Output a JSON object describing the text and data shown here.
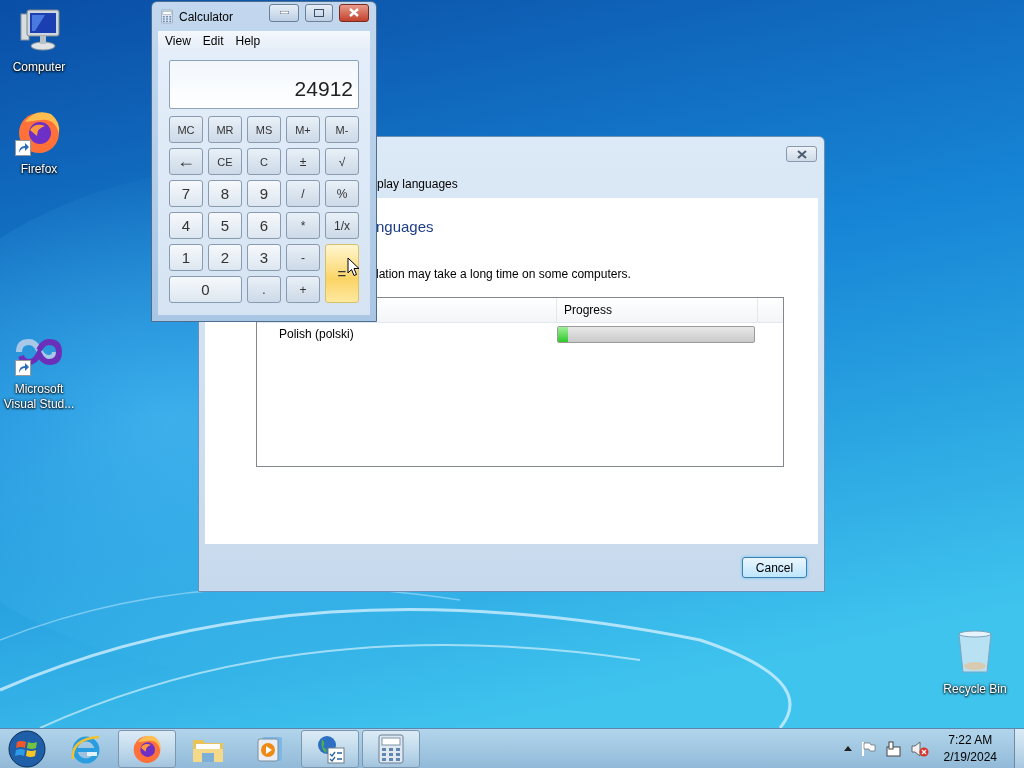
{
  "desktop": {
    "icons": [
      {
        "label": "Computer",
        "kind": "computer",
        "shortcut": false
      },
      {
        "label": "Firefox",
        "kind": "firefox",
        "shortcut": true
      },
      {
        "label": "Microsoft Visual Stud...",
        "kind": "visual-studio",
        "shortcut": true
      },
      {
        "label": "Recycle Bin",
        "kind": "recycle-bin",
        "shortcut": false
      }
    ]
  },
  "dialog": {
    "title": "play languages",
    "heading": "nguages",
    "message": "lation may take a long time on some computers.",
    "list": {
      "columns": [
        "Progress"
      ],
      "rows": [
        {
          "name": "Polish (polski)",
          "level": 0.05
        }
      ]
    },
    "buttons": [
      "Cancel"
    ]
  },
  "calculator": {
    "title": "Calculator",
    "menu": [
      "View",
      "Edit",
      "Help"
    ],
    "display": "24912",
    "buttons": [
      {
        "label": "MC",
        "kind": "memory",
        "hovered": false
      },
      {
        "label": "MR",
        "kind": "memory",
        "hovered": false
      },
      {
        "label": "MS",
        "kind": "memory",
        "hovered": false
      },
      {
        "label": "M+",
        "kind": "memory",
        "hovered": false
      },
      {
        "label": "M-",
        "kind": "memory",
        "hovered": false
      },
      {
        "label": "←",
        "kind": "op",
        "hovered": false
      },
      {
        "label": "CE",
        "kind": "memory",
        "hovered": false
      },
      {
        "label": "C",
        "kind": "memory",
        "hovered": false
      },
      {
        "label": "±",
        "kind": "op",
        "hovered": false
      },
      {
        "label": "√",
        "kind": "op",
        "hovered": false
      },
      {
        "label": "7",
        "kind": "digit",
        "hovered": false
      },
      {
        "label": "8",
        "kind": "digit",
        "hovered": false
      },
      {
        "label": "9",
        "kind": "digit",
        "hovered": false
      },
      {
        "label": "/",
        "kind": "op",
        "hovered": false
      },
      {
        "label": "%",
        "kind": "op",
        "hovered": false
      },
      {
        "label": "4",
        "kind": "digit",
        "hovered": false
      },
      {
        "label": "5",
        "kind": "digit",
        "hovered": false
      },
      {
        "label": "6",
        "kind": "digit",
        "hovered": false
      },
      {
        "label": "*",
        "kind": "op",
        "hovered": false
      },
      {
        "label": "1/x",
        "kind": "op",
        "hovered": false
      },
      {
        "label": "1",
        "kind": "digit",
        "hovered": false
      },
      {
        "label": "2",
        "kind": "digit",
        "hovered": false
      },
      {
        "label": "3",
        "kind": "digit",
        "hovered": false
      },
      {
        "label": "-",
        "kind": "op",
        "hovered": false
      },
      {
        "label": "=",
        "kind": "tall",
        "hovered": true
      },
      {
        "label": "0",
        "kind": "wide",
        "hovered": false
      },
      {
        "label": ".",
        "kind": "op",
        "hovered": false
      },
      {
        "label": "+",
        "kind": "op",
        "hovered": false
      }
    ]
  },
  "taskbar": {
    "items": [
      {
        "kind": "internet-explorer",
        "open": false
      },
      {
        "kind": "firefox",
        "open": true
      },
      {
        "kind": "file-explorer",
        "open": false
      },
      {
        "kind": "media-player",
        "open": false
      },
      {
        "kind": "language-setup",
        "open": true
      },
      {
        "kind": "calculator",
        "open": true
      }
    ],
    "tray": {
      "volume_muted": true,
      "time": "7:22 AM",
      "date": "2/19/2024"
    }
  }
}
